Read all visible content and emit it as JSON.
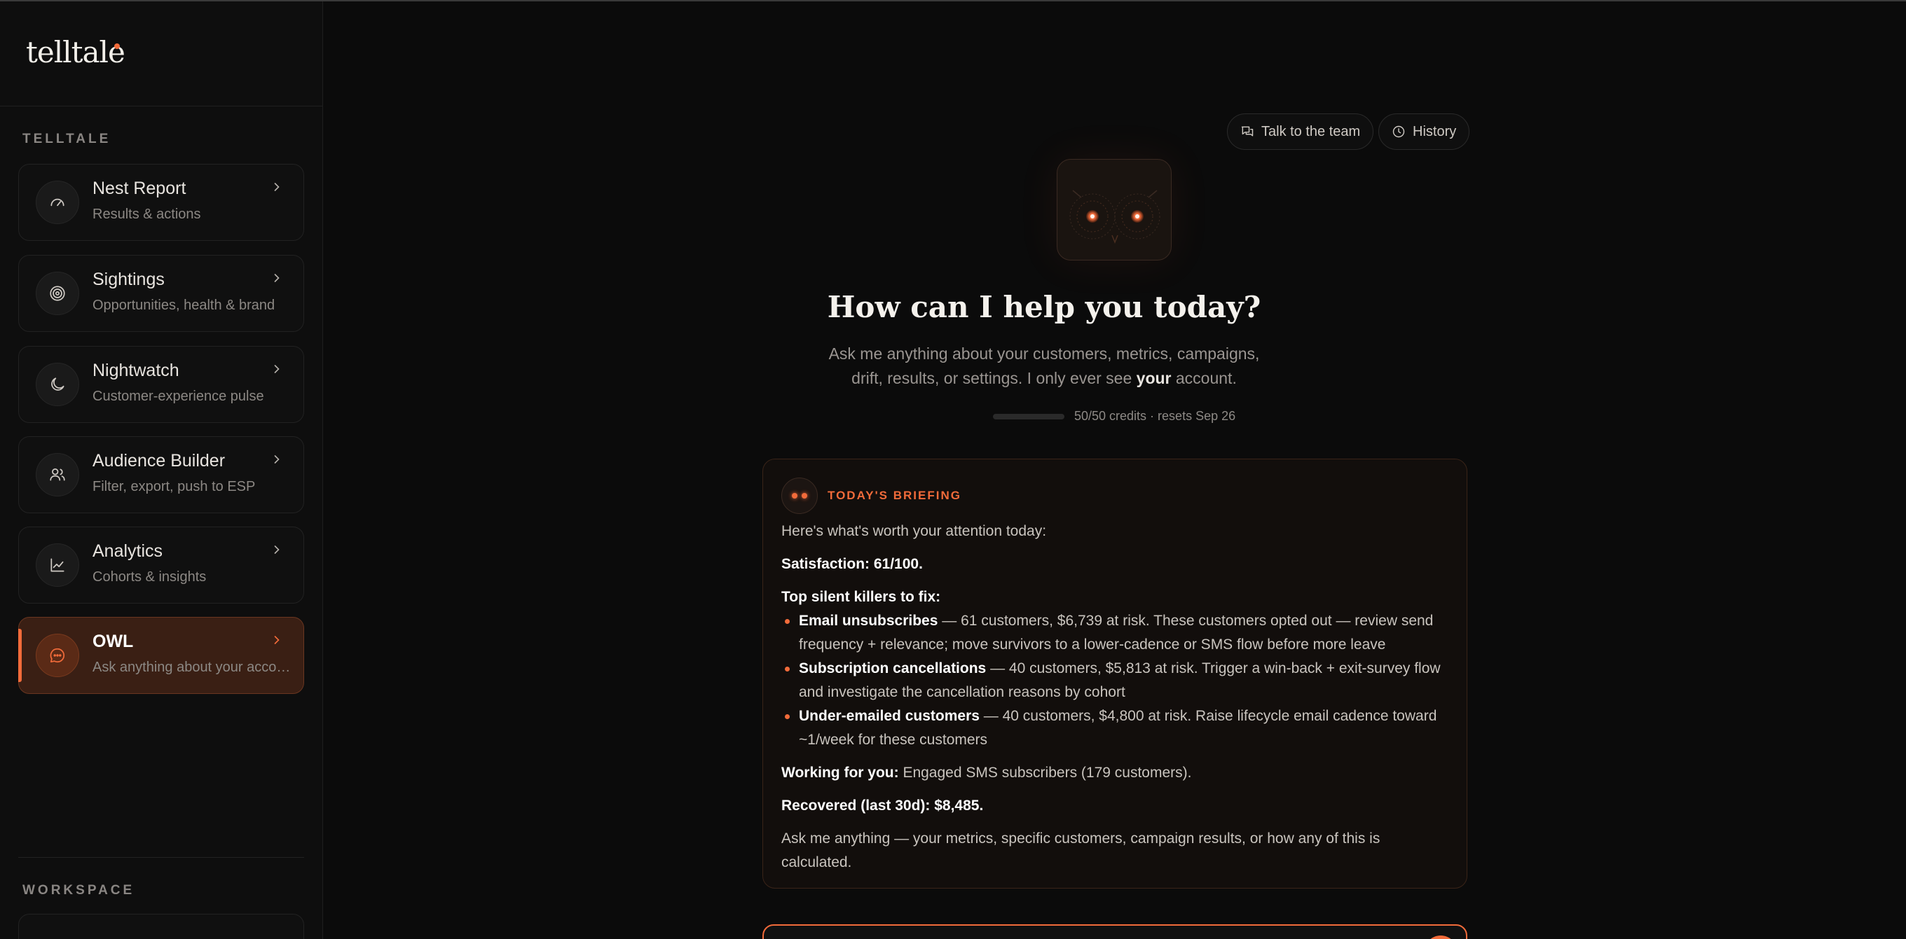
{
  "brand": {
    "name": "telltale"
  },
  "sidebar": {
    "section_label": "TELLTALE",
    "items": [
      {
        "title": "Nest Report",
        "subtitle": "Results & actions",
        "icon": "gauge-icon"
      },
      {
        "title": "Sightings",
        "subtitle": "Opportunities, health & brand",
        "icon": "target-icon"
      },
      {
        "title": "Nightwatch",
        "subtitle": "Customer-experience pulse",
        "icon": "moon-icon"
      },
      {
        "title": "Audience Builder",
        "subtitle": "Filter, export, push to ESP",
        "icon": "users-icon"
      },
      {
        "title": "Analytics",
        "subtitle": "Cohorts & insights",
        "icon": "line-chart-icon"
      },
      {
        "title": "OWL",
        "subtitle": "Ask anything about your account",
        "icon": "chat-bubble-icon",
        "active": true
      }
    ],
    "workspace_label": "WORKSPACE"
  },
  "header": {
    "talk_button": "Talk to the team",
    "history_button": "History"
  },
  "hero": {
    "title": "How can I help you today?",
    "subtitle_before": "Ask me anything about your customers, metrics, campaigns, drift, results, or settings. I only ever see ",
    "subtitle_bold": "your",
    "subtitle_after": " account.",
    "credits_text": "50/50 credits · resets Sep 26"
  },
  "briefing": {
    "label": "TODAY'S BRIEFING",
    "intro": "Here's what's worth your attention today:",
    "satisfaction": "Satisfaction: 61/100.",
    "killers_heading": "Top silent killers to fix:",
    "killers": [
      {
        "name": "Email unsubscribes",
        "text": " — 61 customers, $6,739 at risk. These customers opted out — review send frequency + relevance; move survivors to a lower-cadence or SMS flow before more leave"
      },
      {
        "name": "Subscription cancellations",
        "text": " — 40 customers, $5,813 at risk. Trigger a win-back + exit-survey flow and investigate the cancellation reasons by cohort"
      },
      {
        "name": "Under-emailed customers",
        "text": " — 40 customers, $4,800 at risk. Raise lifecycle email cadence toward ~1/week for these customers"
      }
    ],
    "working_label": "Working for you:",
    "working_text": " Engaged SMS subscribers (179 customers).",
    "recovered": "Recovered (last 30d): $8,485.",
    "outro": "Ask me anything — your metrics, specific customers, campaign results, or how any of this is calculated."
  },
  "colors": {
    "accent": "#f26b3a",
    "background": "#0b0b0b"
  }
}
